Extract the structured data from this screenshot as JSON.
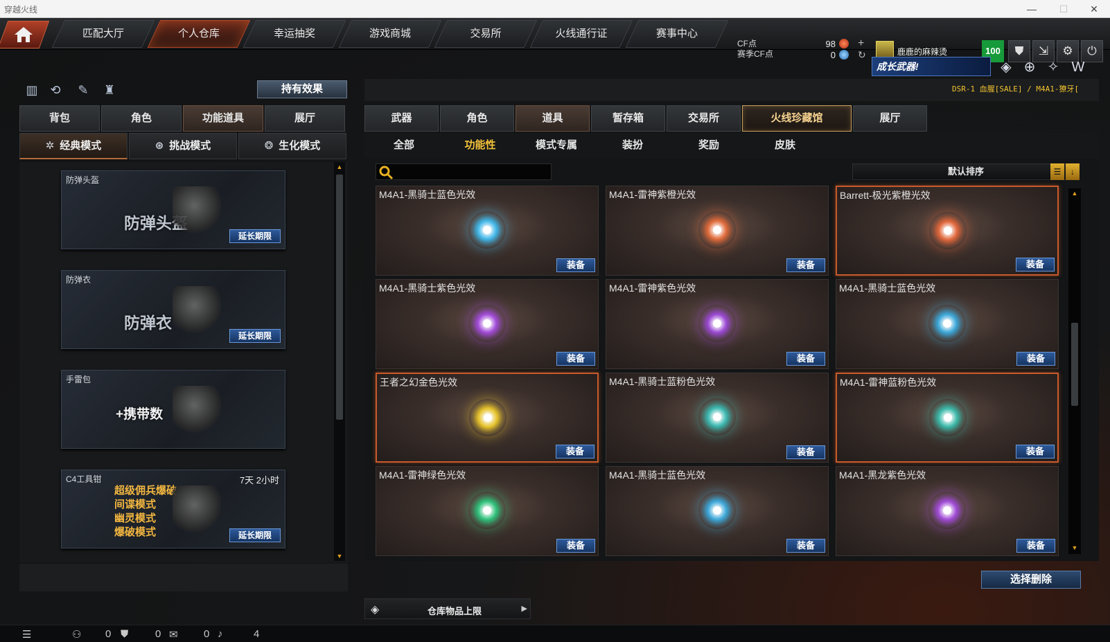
{
  "window": {
    "title": "穿越火线"
  },
  "topnav": {
    "tabs": [
      "匹配大厅",
      "个人仓库",
      "幸运抽奖",
      "游戏商城",
      "交易所",
      "火线通行证",
      "赛事中心"
    ],
    "active": 1
  },
  "currency": {
    "cf_label": "CF点",
    "season_cf_label": "赛季CF点",
    "cf_value": "98",
    "season_cf_value": "0"
  },
  "user": {
    "name": "鹿鹿的麻辣烫",
    "level": "100"
  },
  "banner": {
    "text": "成长武器!",
    "ticker": "DSR-1 血腥[SALE] / M4A1-獠牙["
  },
  "left": {
    "hold_effect": "持有效果",
    "tabs": [
      "背包",
      "角色",
      "功能道具",
      "展厅"
    ],
    "active_tab": 2,
    "modes": [
      "经典模式",
      "挑战模式",
      "生化模式"
    ],
    "active_mode": 0,
    "items": [
      {
        "name": "防弹头盔",
        "big": "防弹头盔",
        "btn": "延长期限",
        "time": ""
      },
      {
        "name": "防弹衣",
        "big": "防弹衣",
        "btn": "延长期限",
        "time": ""
      },
      {
        "name": "手雷包",
        "big": "+携带数",
        "btn": "",
        "time": ""
      },
      {
        "name": "C4工具钳",
        "big": "",
        "btn": "延长期限",
        "time": "7天 2小时",
        "lines": [
          "超级佣兵爆破",
          "间谍模式",
          "幽灵模式",
          "爆破模式"
        ]
      }
    ]
  },
  "right": {
    "tabs": [
      "武器",
      "角色",
      "道具",
      "暂存箱",
      "交易所",
      "火线珍藏馆",
      "展厅"
    ],
    "active_tab": 2,
    "highlight_tab": 5,
    "subtabs": [
      "全部",
      "功能性",
      "模式专属",
      "装扮",
      "奖励",
      "皮肤"
    ],
    "active_subtab": 1,
    "search_placeholder": "",
    "sort_label": "默认排序",
    "equip_label": "装备",
    "items": [
      {
        "name": "M4A1-黑骑士蓝色光效",
        "color": "#3fb6e8",
        "hl": false
      },
      {
        "name": "M4A1-雷神紫橙光效",
        "color": "#e06a3a",
        "hl": false
      },
      {
        "name": "Barrett-极光紫橙光效",
        "color": "#e0663a",
        "hl": true
      },
      {
        "name": "M4A1-黑骑士紫色光效",
        "color": "#a14ad8",
        "hl": false
      },
      {
        "name": "M4A1-雷神紫色光效",
        "color": "#9a48d2",
        "hl": false
      },
      {
        "name": "M4A1-黑骑士蓝色光效",
        "color": "#3aa6d8",
        "hl": false
      },
      {
        "name": "王者之幻金色光效",
        "color": "#e6c22a",
        "hl": true
      },
      {
        "name": "M4A1-黑骑士蓝粉色光效",
        "color": "#3ab8b0",
        "hl": false
      },
      {
        "name": "M4A1-雷神蓝粉色光效",
        "color": "#3ab8a8",
        "hl": true
      },
      {
        "name": "M4A1-雷神绿色光效",
        "color": "#2ec07a",
        "hl": false
      },
      {
        "name": "M4A1-黑骑士蓝色光效",
        "color": "#3aa6d8",
        "hl": false
      },
      {
        "name": "M4A1-黑龙紫色光效",
        "color": "#a04ad6",
        "hl": false
      }
    ],
    "delete_label": "选择删除",
    "capacity_label": "仓库物品上限"
  },
  "status": {
    "v1": "0",
    "v2": "0",
    "v3": "0",
    "v4": "4"
  }
}
